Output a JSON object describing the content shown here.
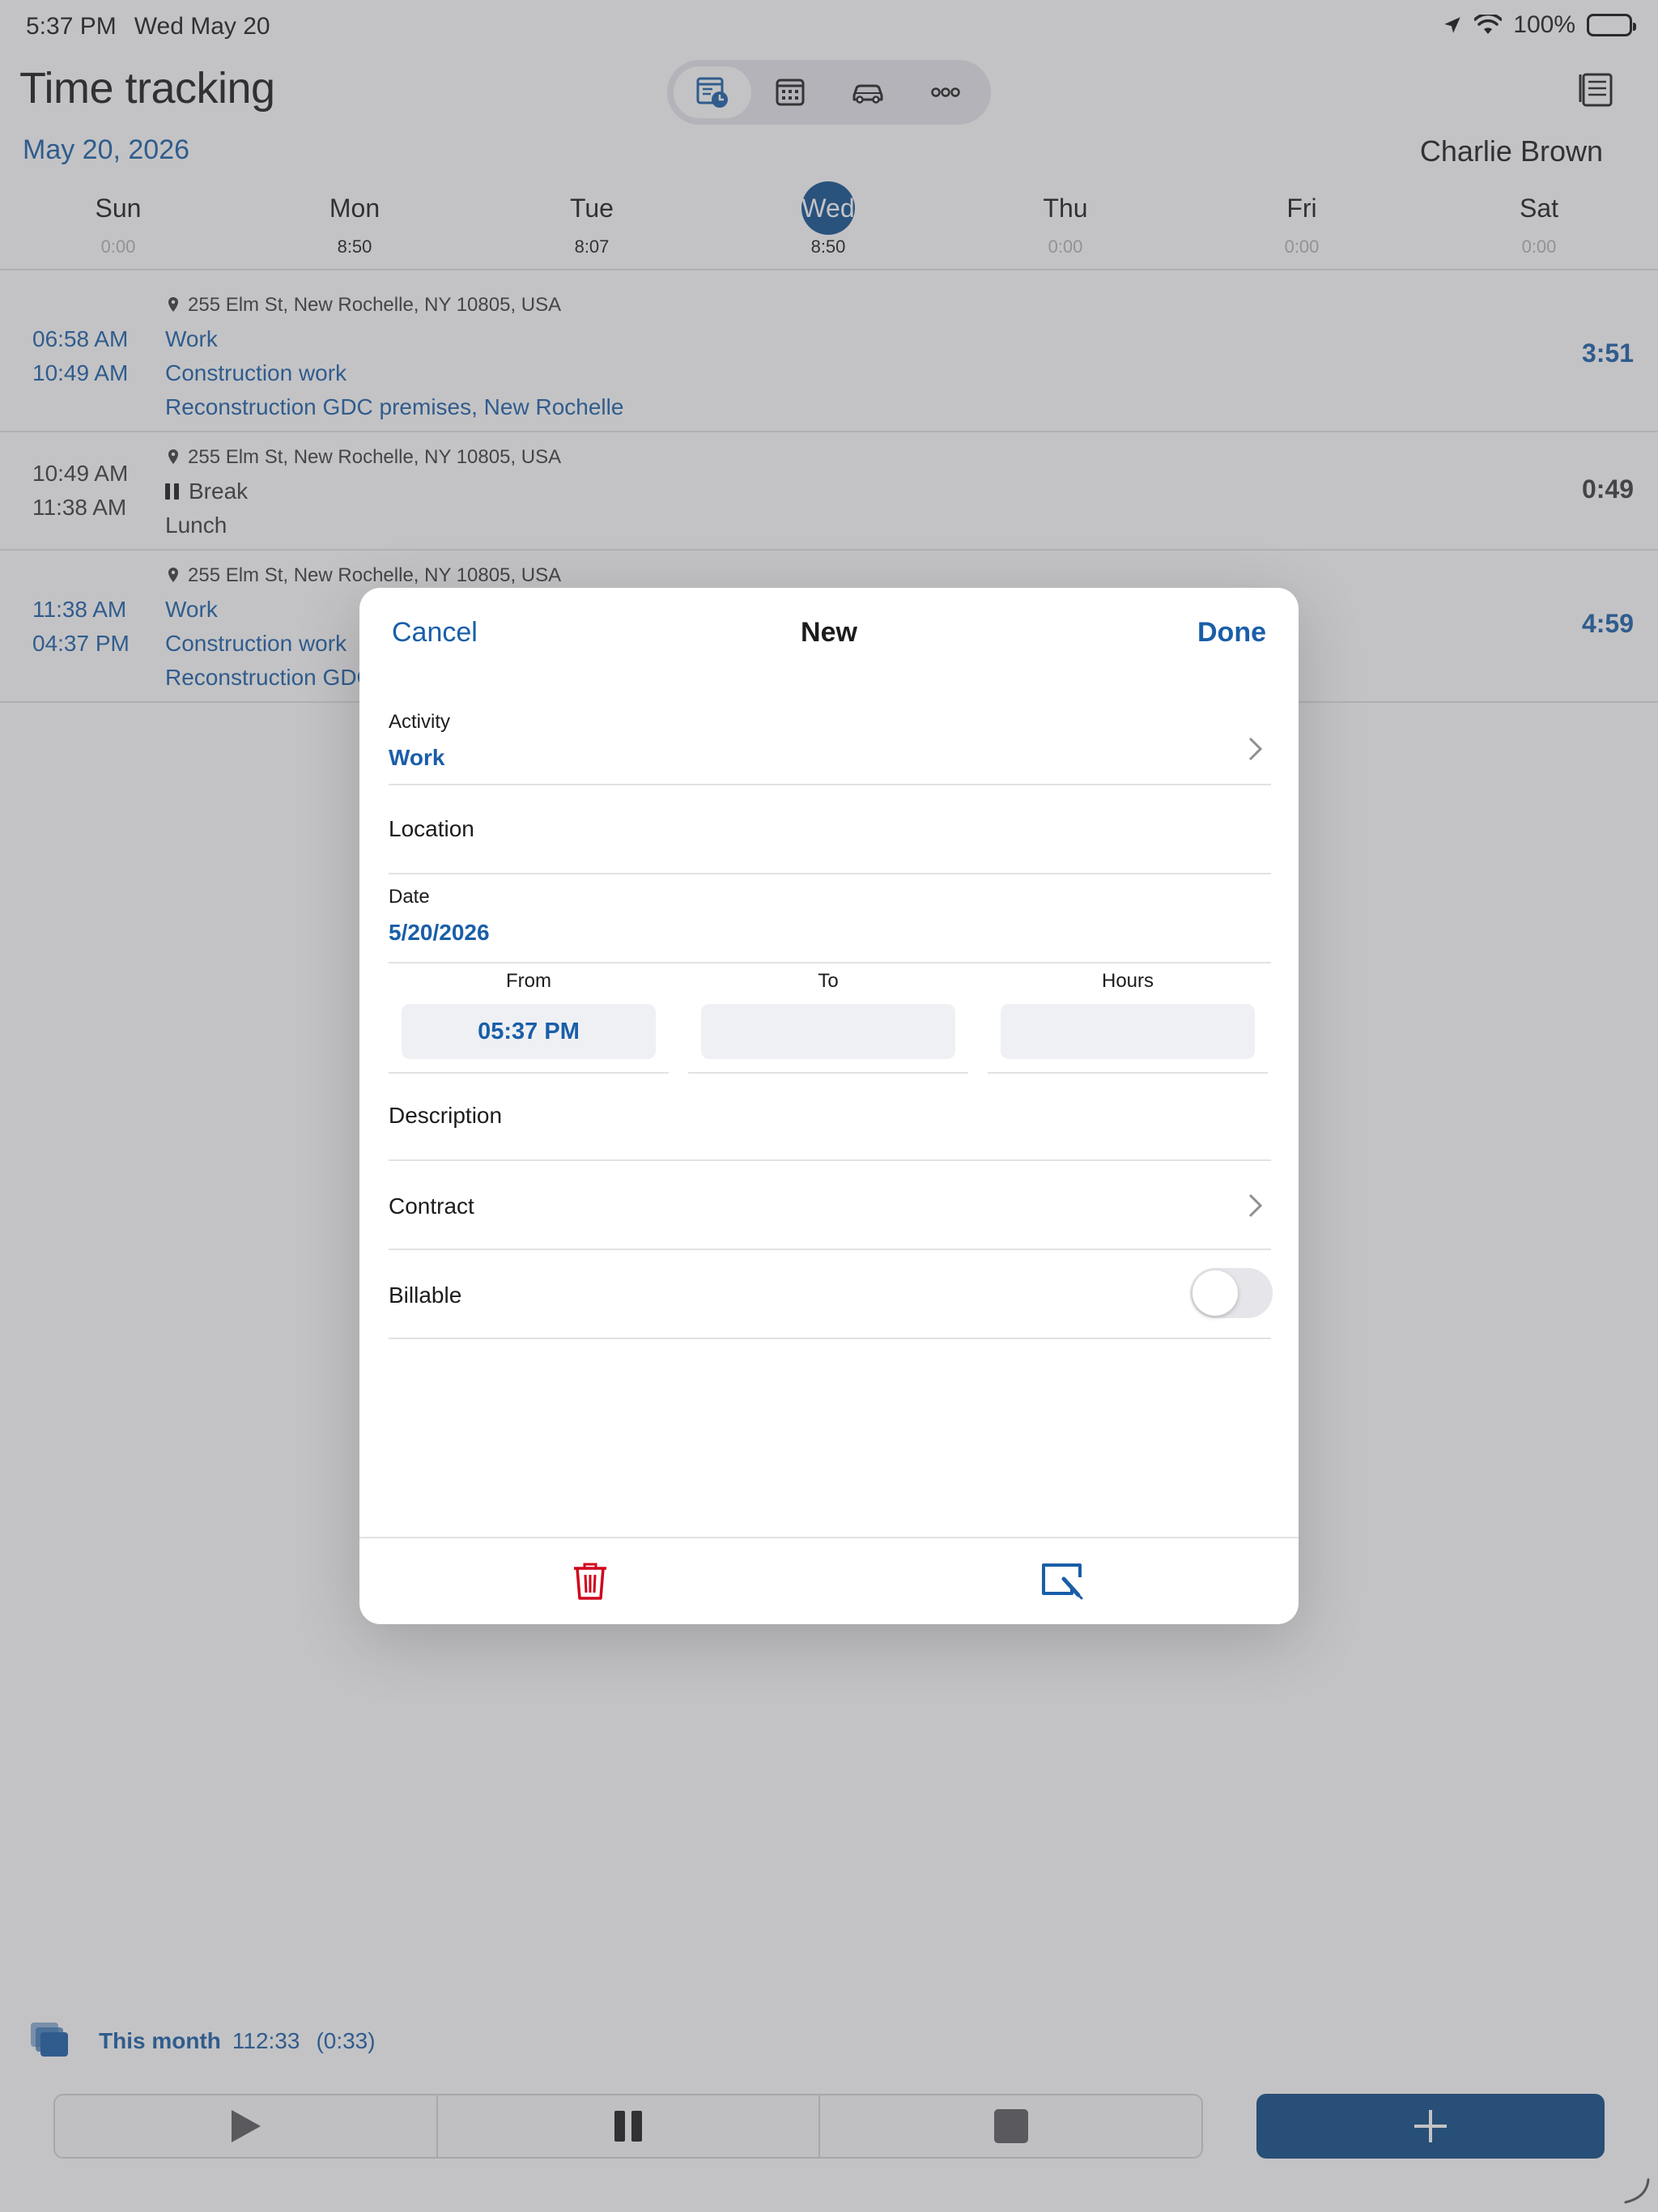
{
  "status_bar": {
    "time": "5:37 PM",
    "date": "Wed May 20",
    "battery": "100%",
    "icons": [
      "location-arrow-icon",
      "wifi-icon",
      "battery-icon"
    ]
  },
  "header": {
    "title": "Time tracking",
    "view_tabs": [
      {
        "name": "time-entries",
        "icon": "timesheet-clock-icon",
        "active": true
      },
      {
        "name": "calendar",
        "icon": "calendar-grid-icon",
        "active": false
      },
      {
        "name": "mileage",
        "icon": "car-icon",
        "active": false
      },
      {
        "name": "more",
        "icon": "more-dots-icon",
        "active": false
      }
    ],
    "report_icon": "report-list-icon",
    "date": "May 20, 2026",
    "user": "Charlie Brown"
  },
  "week": {
    "days": [
      {
        "name": "Sun",
        "hours": "0:00"
      },
      {
        "name": "Mon",
        "hours": "8:50"
      },
      {
        "name": "Tue",
        "hours": "8:07"
      },
      {
        "name": "Wed",
        "hours": "8:50"
      },
      {
        "name": "Thu",
        "hours": "0:00"
      },
      {
        "name": "Fri",
        "hours": "0:00"
      },
      {
        "name": "Sat",
        "hours": "0:00"
      }
    ],
    "selected": "Wed"
  },
  "entries": [
    {
      "start": "06:58 AM",
      "end": "10:49 AM",
      "location": "255 Elm St, New Rochelle, NY 10805, USA",
      "activity": "Work",
      "task": "Construction work",
      "project": "Reconstruction GDC premises, New Rochelle",
      "duration": "3:51"
    },
    {
      "start": "10:49 AM",
      "end": "11:38 AM",
      "location": "255 Elm St, New Rochelle, NY 10805, USA",
      "activity": "Break",
      "note": "Lunch",
      "duration": "0:49"
    },
    {
      "start": "11:38 AM",
      "end": "04:37 PM",
      "location": "255 Elm St, New Rochelle, NY 10805, USA",
      "activity": "Work",
      "task": "Construction work",
      "project": "Reconstruction GDC premises, New Rochelle",
      "duration": "4:59"
    }
  ],
  "footer": {
    "month_label": "This month",
    "month_total": "112:33",
    "month_extra": "(0:33)",
    "controls": [
      "play-icon",
      "pause-icon",
      "stop-icon"
    ],
    "add_icon": "plus-icon"
  },
  "sheet": {
    "cancel": "Cancel",
    "title": "New",
    "done": "Done",
    "activity_label": "Activity",
    "activity_value": "Work",
    "location_label": "Location",
    "date_label": "Date",
    "date_value": "5/20/2026",
    "from_label": "From",
    "from_value": "05:37 PM",
    "to_label": "To",
    "to_value": "",
    "hours_label": "Hours",
    "hours_value": "",
    "description_label": "Description",
    "contract_label": "Contract",
    "billable_label": "Billable",
    "billable_on": false,
    "toolbar_icons": [
      "trash-icon",
      "signature-icon"
    ]
  },
  "colors": {
    "accent": "#1a5ea8",
    "primary_button": "#0d4a85",
    "destructive": "#d0021b"
  }
}
